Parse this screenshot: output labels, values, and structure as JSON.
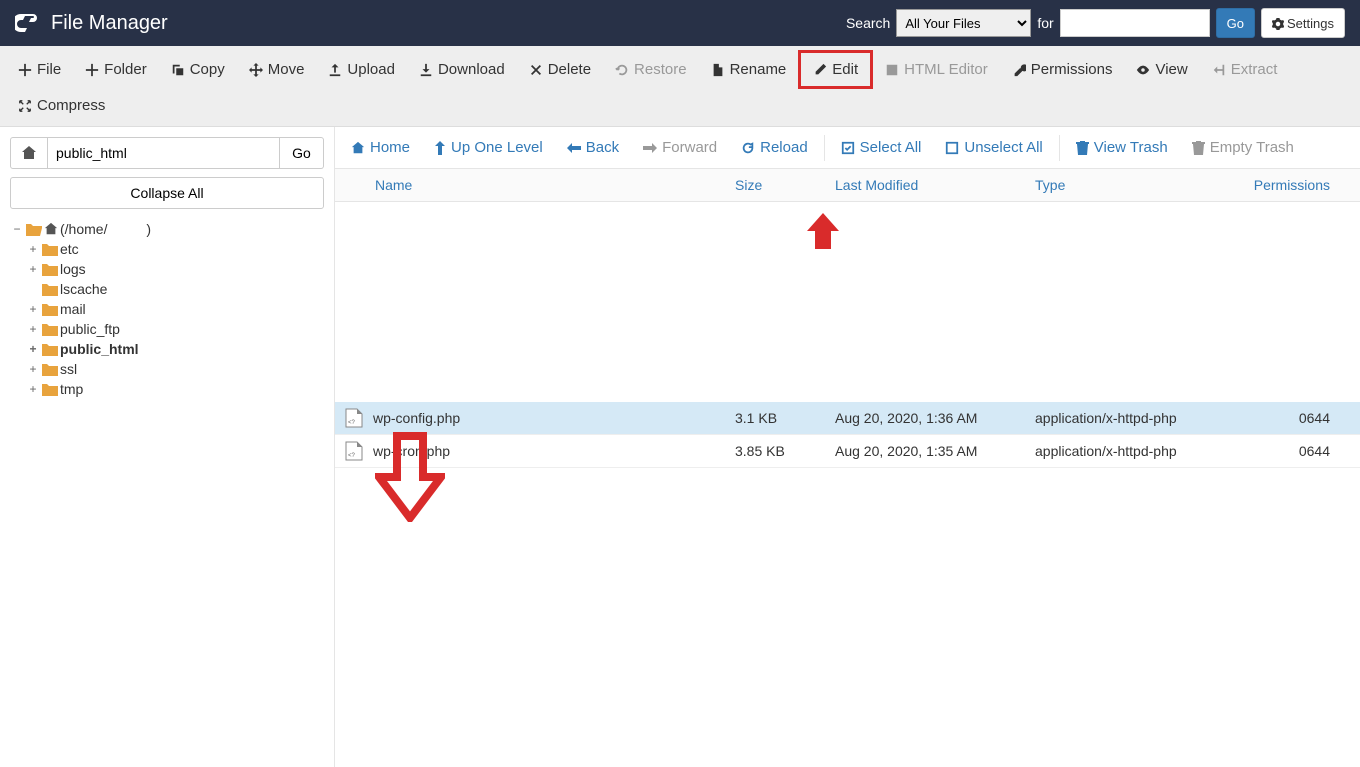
{
  "header": {
    "title": "File Manager",
    "search_label": "Search",
    "search_scope": "All Your Files",
    "for_label": "for",
    "search_value": "",
    "go_label": "Go",
    "settings_label": "Settings"
  },
  "toolbar": {
    "file": "File",
    "folder": "Folder",
    "copy": "Copy",
    "move": "Move",
    "upload": "Upload",
    "download": "Download",
    "delete": "Delete",
    "restore": "Restore",
    "rename": "Rename",
    "edit": "Edit",
    "html_editor": "HTML Editor",
    "permissions": "Permissions",
    "view": "View",
    "extract": "Extract",
    "compress": "Compress"
  },
  "sidebar": {
    "path_value": "public_html",
    "go_label": "Go",
    "collapse_label": "Collapse All",
    "tree_root_prefix": "(/home/",
    "tree_root_suffix": ")",
    "folders": {
      "etc": "etc",
      "logs": "logs",
      "lscache": "lscache",
      "mail": "mail",
      "public_ftp": "public_ftp",
      "public_html": "public_html",
      "ssl": "ssl",
      "tmp": "tmp"
    }
  },
  "nav": {
    "home": "Home",
    "up": "Up One Level",
    "back": "Back",
    "forward": "Forward",
    "reload": "Reload",
    "select_all": "Select All",
    "unselect_all": "Unselect All",
    "view_trash": "View Trash",
    "empty_trash": "Empty Trash"
  },
  "table": {
    "headers": {
      "name": "Name",
      "size": "Size",
      "modified": "Last Modified",
      "type": "Type",
      "permissions": "Permissions"
    },
    "rows": [
      {
        "name": "wp-config.php",
        "size": "3.1 KB",
        "modified": "Aug 20, 2020, 1:36 AM",
        "type": "application/x-httpd-php",
        "perm": "0644",
        "selected": true
      },
      {
        "name": "wp-cron.php",
        "size": "3.85 KB",
        "modified": "Aug 20, 2020, 1:35 AM",
        "type": "application/x-httpd-php",
        "perm": "0644",
        "selected": false
      }
    ]
  }
}
